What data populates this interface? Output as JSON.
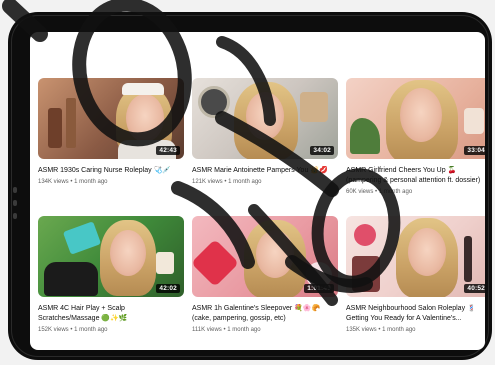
{
  "videos": [
    {
      "title": "ASMR 1930s Caring Nurse Roleplay 🩺💉",
      "title_2": "",
      "views": "134K views",
      "age": "1 month ago",
      "duration": "42:43",
      "bg": "#b8866a"
    },
    {
      "title": "ASMR Marie Antoinette Pampers You 👑💋",
      "title_2": "",
      "views": "121K views",
      "age": "1 month ago",
      "duration": "34:02",
      "bg": "#d8d2cc"
    },
    {
      "title": "ASMR Girlfriend Cheers You Up 🍒",
      "title_2": "(pampering & personal attention ft. dossier)",
      "views": "60K views",
      "age": "1 month ago",
      "duration": "33:04",
      "bg": "#e7b8a5"
    },
    {
      "title": "ASMR 4C Hair Play + Scalp",
      "title_2": "Scratches/Massage 🟢✨🌿",
      "views": "152K views",
      "age": "1 month ago",
      "duration": "42:02",
      "bg": "#3f8a3a"
    },
    {
      "title": "ASMR 1h Galentine's Sleepover 💐🌸🥐",
      "title_2": "(cake, pampering, gossip, etc)",
      "views": "111K views",
      "age": "1 month ago",
      "duration": "1:01:46",
      "bg": "#e9a3aa"
    },
    {
      "title": "ASMR Neighbourhood Salon Roleplay 💈",
      "title_2": "Getting You Ready for A Valentine's...",
      "views": "135K views",
      "age": "1 month ago",
      "duration": "40:52",
      "bg": "#efd7d3"
    }
  ],
  "colors": {
    "tablet": "#0d0d0d",
    "screen": "#ffffff",
    "overlay_stroke": "#111111"
  },
  "icons": {
    "duration_badge": "duration-badge"
  }
}
